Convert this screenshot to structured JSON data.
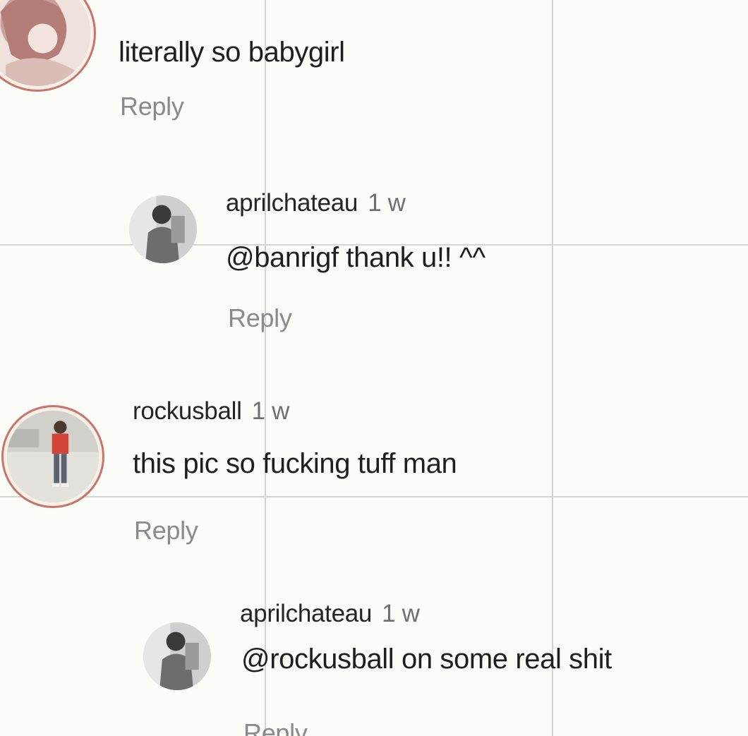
{
  "comments": [
    {
      "username": "",
      "time": "",
      "text": "literally so babygirl",
      "reply_label": "Reply",
      "avatar_icon": "profile-photo-anime-icon"
    },
    {
      "username": "aprilchateau",
      "time": "1 w",
      "text": "@banrigf thank u!! ^^",
      "reply_label": "Reply",
      "avatar_icon": "profile-photo-person-icon"
    },
    {
      "username": "rockusball",
      "time": "1 w",
      "text": "this pic so fucking tuff man",
      "reply_label": "Reply",
      "avatar_icon": "profile-photo-person-red-shirt-icon"
    },
    {
      "username": "aprilchateau",
      "time": "1 w",
      "text": "@rockusball on some real shit",
      "reply_label": "Reply",
      "avatar_icon": "profile-photo-person-icon"
    }
  ],
  "colors": {
    "background": "#fbfbf8",
    "grid_line": "#d4d4d0",
    "avatar_ring": "#c9746a",
    "reply_text": "#8a8a8a",
    "time_text": "#6f6f6f"
  }
}
